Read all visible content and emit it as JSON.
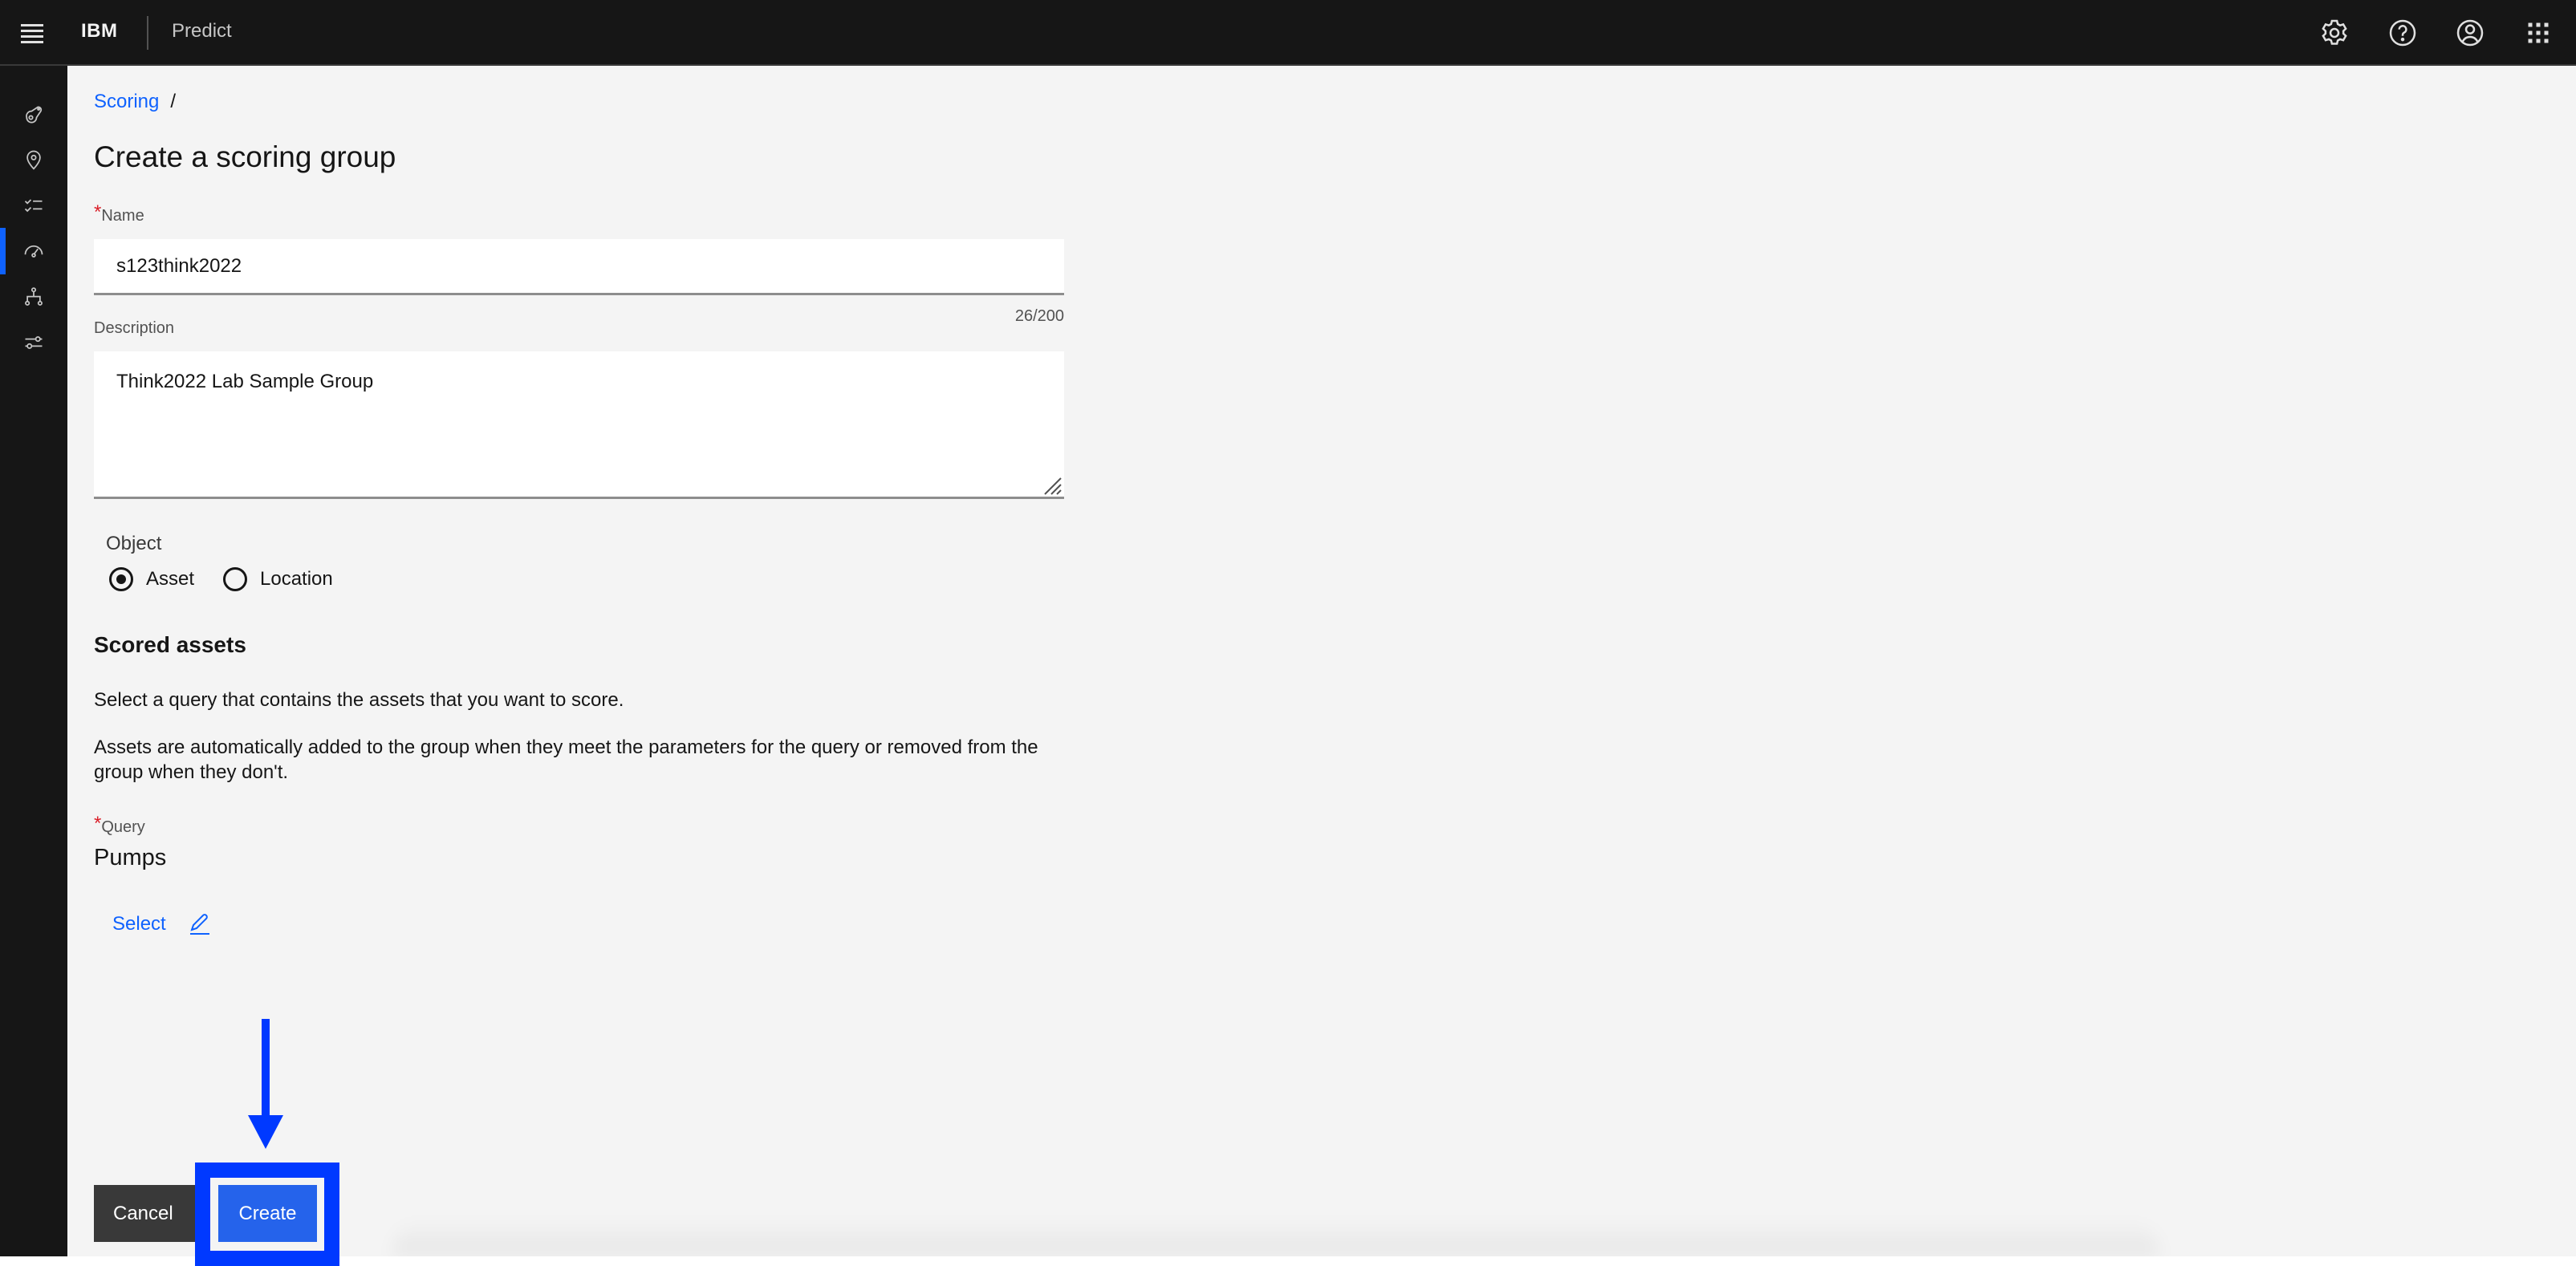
{
  "header": {
    "brand": "IBM",
    "product": "Predict",
    "icons": [
      "menu-icon",
      "settings-icon",
      "help-icon",
      "user-icon",
      "app-switcher-icon"
    ]
  },
  "sidebar": {
    "items": [
      {
        "name": "assets",
        "icon": "asset-icon",
        "active": false
      },
      {
        "name": "locations",
        "icon": "location-icon",
        "active": false
      },
      {
        "name": "checklist",
        "icon": "checklist-icon",
        "active": false
      },
      {
        "name": "scoring",
        "icon": "gauge-icon",
        "active": true
      },
      {
        "name": "hierarchy",
        "icon": "hierarchy-icon",
        "active": false
      },
      {
        "name": "settings",
        "icon": "sliders-icon",
        "active": false
      }
    ]
  },
  "breadcrumb": {
    "items": [
      {
        "label": "Scoring"
      }
    ],
    "separator": "/"
  },
  "page": {
    "title": "Create a scoring group"
  },
  "form": {
    "required_marker": "*",
    "name": {
      "label": "Name",
      "value": "s123think2022",
      "counter": "26/200"
    },
    "description": {
      "label": "Description",
      "value": "Think2022 Lab Sample Group"
    },
    "object": {
      "label": "Object",
      "options": [
        {
          "label": "Asset",
          "checked": true
        },
        {
          "label": "Location",
          "checked": false
        }
      ]
    },
    "scored_assets": {
      "title": "Scored assets",
      "help1": "Select a query that contains the assets that you want to score.",
      "help2": "Assets are automatically added to the group when they meet the parameters for the query or removed from the group when they don't."
    },
    "query": {
      "label": "Query",
      "value": "Pumps",
      "select_label": "Select"
    }
  },
  "actions": {
    "cancel_label": "Cancel",
    "create_label": "Create"
  },
  "annotation": {
    "color": "#0039ff",
    "target": "create-button"
  },
  "colors": {
    "accent": "#0f62fe",
    "header_bg": "#161616",
    "page_bg": "#f4f4f4",
    "required": "#da1e28"
  }
}
